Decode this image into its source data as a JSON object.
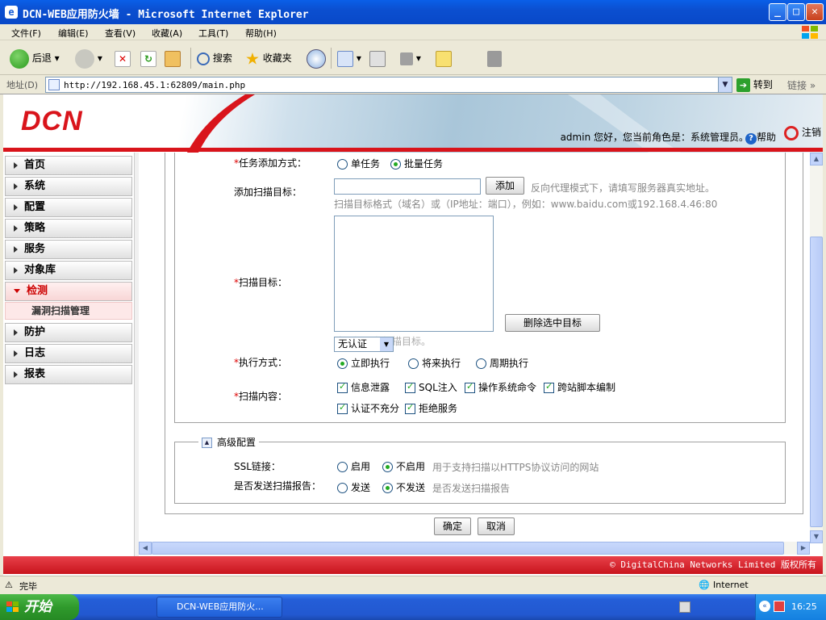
{
  "window": {
    "title": "DCN-WEB应用防火墙 - Microsoft Internet Explorer",
    "min": "_",
    "max": "□",
    "close": "✕"
  },
  "menu": [
    "文件(F)",
    "编辑(E)",
    "查看(V)",
    "收藏(A)",
    "工具(T)",
    "帮助(H)"
  ],
  "toolbar": {
    "back": "后退",
    "search": "搜索",
    "favorites": "收藏夹"
  },
  "address": {
    "label": "地址(D)",
    "url": "http://192.168.45.1:62809/main.php",
    "go": "转到",
    "links": "链接"
  },
  "header": {
    "logo": "DCN",
    "user_info": "admin 您好，您当前角色是：系统管理员。",
    "help": "帮助",
    "logout": "注销"
  },
  "sidebar": {
    "items": [
      "首页",
      "系统",
      "配置",
      "策略",
      "服务",
      "对象库",
      "检测",
      "防护",
      "日志",
      "报表"
    ],
    "active": "检测",
    "subitem": "漏洞扫描管理"
  },
  "form": {
    "task_mode_label": "任务添加方式：",
    "task_single": "单任务",
    "task_batch": "批量任务",
    "add_target_label": "添加扫描目标：",
    "add_button": "添加",
    "proxy_hint": "反向代理模式下，请填写服务器真实地址。",
    "format_hint": "扫描目标格式（域名）或（IP地址：端口），例如：www.baidu.com或192.168.4.46:80",
    "scan_target_label": "扫描目标：",
    "delete_selected": "删除选中目标",
    "hidden_hint": "请添加一条扫描目标。",
    "auth_value": "无认证",
    "exec_label": "执行方式：",
    "exec_now": "立即执行",
    "exec_later": "将来执行",
    "exec_periodic": "周期执行",
    "content_label": "扫描内容：",
    "checks": [
      "信息泄露",
      "SQL注入",
      "操作系统命令",
      "跨站脚本编制",
      "认证不充分",
      "拒绝服务"
    ],
    "required_mark": "*"
  },
  "advanced": {
    "legend": "高级配置",
    "ssl_label": "SSL链接：",
    "ssl_on": "启用",
    "ssl_off": "不启用",
    "ssl_hint": "用于支持扫描以HTTPS协议访问的网站",
    "report_label": "是否发送扫描报告：",
    "report_send": "发送",
    "report_nosend": "不发送",
    "report_hint": "是否发送扫描报告"
  },
  "actions": {
    "ok": "确定",
    "cancel": "取消"
  },
  "footer": {
    "copyright": "© DigitalChina Networks Limited 版权所有"
  },
  "status": {
    "done": "完毕",
    "zone": "Internet"
  },
  "taskbar": {
    "start": "开始",
    "task": "DCN-WEB应用防火...",
    "clock": "16:25"
  },
  "colors": {
    "brand_red": "#d9141b",
    "xp_blue": "#245ed8",
    "radio_dot": "#22aa22"
  }
}
